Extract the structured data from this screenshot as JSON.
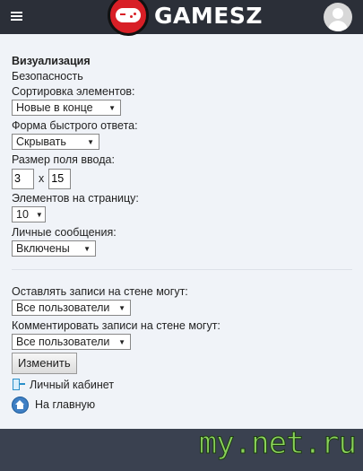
{
  "header": {
    "logo_text": "GAMESZ"
  },
  "settings": {
    "section_title": "Визуализация",
    "security_label": "Безопасность",
    "sort": {
      "label": "Сортировка элементов:",
      "value": "Новые в конце"
    },
    "quick_reply": {
      "label": "Форма быстрого ответа:",
      "value": "Скрывать"
    },
    "input_size": {
      "label": "Размер поля ввода:",
      "rows": "3",
      "separator": "x",
      "cols": "15"
    },
    "per_page": {
      "label": "Элементов на страницу:",
      "value": "10"
    },
    "messages": {
      "label": "Личные сообщения:",
      "value": "Включены"
    },
    "wall_post": {
      "label": "Оставлять записи на стене могут:",
      "value": "Все пользователи"
    },
    "wall_comment": {
      "label": "Комментировать записи на стене могут:",
      "value": "Все пользователи"
    },
    "submit_label": "Изменить"
  },
  "links": {
    "cabinet": "Личный кабинет",
    "home": "На главную"
  },
  "watermark": "my.net.ru",
  "colors": {
    "header_bg": "#2b2f38",
    "page_bg": "#f0f3f8",
    "logo_red": "#d81f26",
    "watermark_green": "#8ad25a"
  }
}
